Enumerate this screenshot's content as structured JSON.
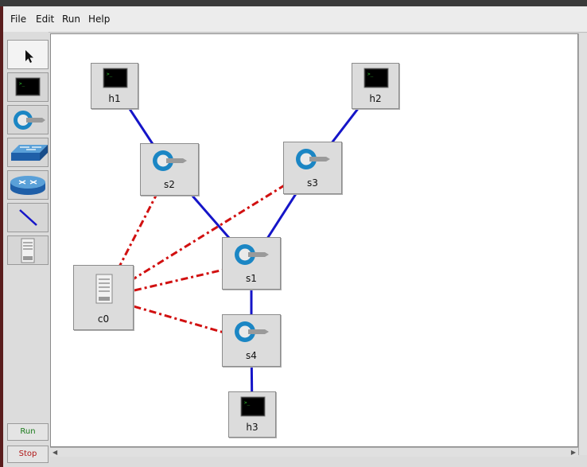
{
  "menu": {
    "items": [
      "File",
      "Edit",
      "Run",
      "Help"
    ]
  },
  "toolbox": {
    "tools": [
      {
        "name": "select",
        "icon": "pointer-icon"
      },
      {
        "name": "host",
        "icon": "terminal-icon"
      },
      {
        "name": "switch",
        "icon": "switch-icon"
      },
      {
        "name": "legacy-switch",
        "icon": "legacy-switch-icon"
      },
      {
        "name": "legacy-router",
        "icon": "router-icon"
      },
      {
        "name": "link",
        "icon": "link-icon"
      },
      {
        "name": "controller",
        "icon": "controller-icon"
      }
    ],
    "run_label": "Run",
    "stop_label": "Stop"
  },
  "topology": {
    "nodes": {
      "h1": {
        "label": "h1",
        "type": "host"
      },
      "h2": {
        "label": "h2",
        "type": "host"
      },
      "h3": {
        "label": "h3",
        "type": "host"
      },
      "s1": {
        "label": "s1",
        "type": "switch"
      },
      "s2": {
        "label": "s2",
        "type": "switch"
      },
      "s3": {
        "label": "s3",
        "type": "switch"
      },
      "s4": {
        "label": "s4",
        "type": "switch"
      },
      "c0": {
        "label": "c0",
        "type": "controller"
      }
    },
    "data_links": [
      [
        "h1",
        "s2"
      ],
      [
        "h2",
        "s3"
      ],
      [
        "s2",
        "s1"
      ],
      [
        "s3",
        "s1"
      ],
      [
        "s1",
        "s4"
      ],
      [
        "s4",
        "h3"
      ]
    ],
    "control_links": [
      [
        "c0",
        "s2"
      ],
      [
        "c0",
        "s3"
      ],
      [
        "c0",
        "s1"
      ],
      [
        "c0",
        "s4"
      ]
    ],
    "colors": {
      "data_link": "#1515c8",
      "control_link": "#d11010"
    }
  }
}
